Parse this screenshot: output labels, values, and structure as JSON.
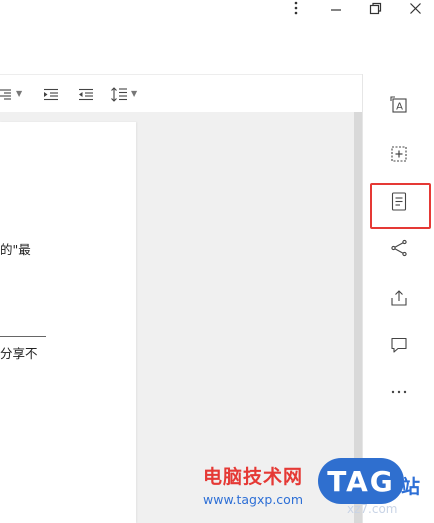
{
  "titlebar": {
    "more_icon": "vertical-ellipsis-icon",
    "minimize_icon": "minimize-icon",
    "restore_icon": "restore-icon",
    "close_icon": "close-icon"
  },
  "toolbar": {
    "items": [
      {
        "icon": "align-right-icon",
        "has_dropdown": true
      },
      {
        "icon": "increase-indent-icon"
      },
      {
        "icon": "decrease-indent-icon"
      },
      {
        "icon": "line-spacing-icon",
        "has_dropdown": true
      }
    ]
  },
  "document": {
    "lines": [
      "的\"最",
      "分享不"
    ]
  },
  "sidebar": {
    "items": [
      {
        "icon": "text-box-icon"
      },
      {
        "icon": "add-frame-icon"
      },
      {
        "icon": "document-outline-icon",
        "highlighted": true
      },
      {
        "icon": "share-icon"
      },
      {
        "icon": "export-icon"
      },
      {
        "icon": "comment-icon"
      },
      {
        "icon": "more-horizontal-icon"
      }
    ],
    "highlight_color": "#e53935"
  },
  "watermark": {
    "title": "电脑技术网",
    "url": "www.tagxp.com",
    "badge": "TAG",
    "site_char": "站",
    "faint": "xz7.com"
  }
}
